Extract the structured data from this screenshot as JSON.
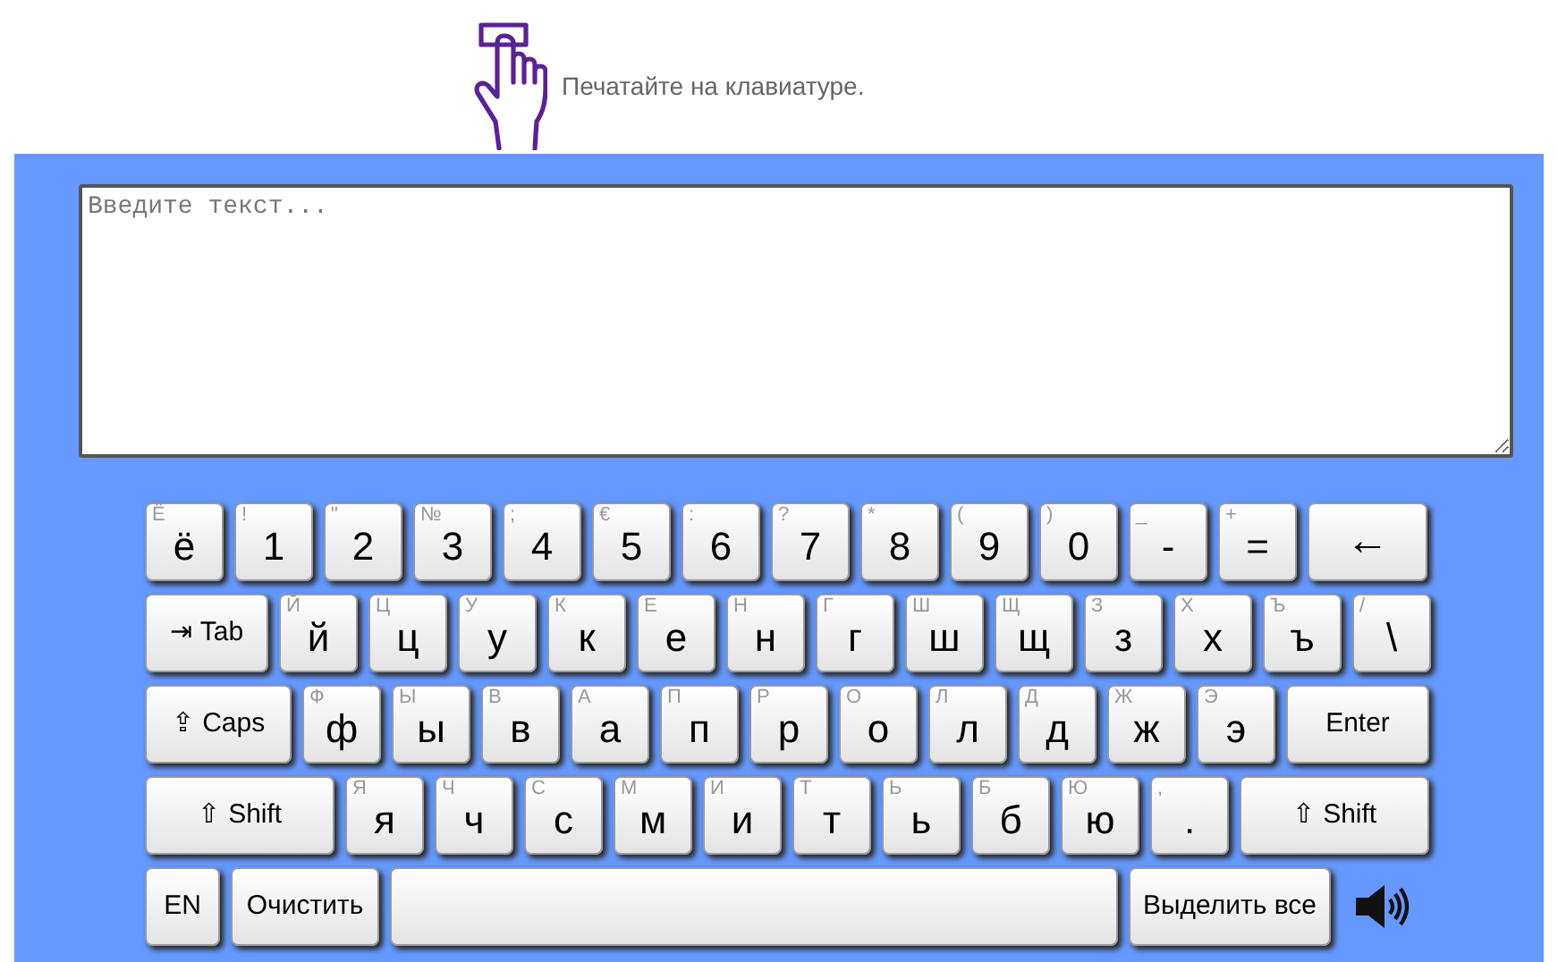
{
  "header": {
    "text": "Печатайте на клавиатуре."
  },
  "editor": {
    "placeholder": "Введите текст..."
  },
  "keyboard": {
    "rows": [
      {
        "keys": [
          {
            "kind": "char",
            "label": "ё",
            "hint": "Ё"
          },
          {
            "kind": "char",
            "label": "1",
            "hint": "!"
          },
          {
            "kind": "char",
            "label": "2",
            "hint": "\""
          },
          {
            "kind": "char",
            "label": "3",
            "hint": "№"
          },
          {
            "kind": "char",
            "label": "4",
            "hint": ";"
          },
          {
            "kind": "char",
            "label": "5",
            "hint": "€"
          },
          {
            "kind": "char",
            "label": "6",
            "hint": ":"
          },
          {
            "kind": "char",
            "label": "7",
            "hint": "?"
          },
          {
            "kind": "char",
            "label": "8",
            "hint": "*"
          },
          {
            "kind": "char",
            "label": "9",
            "hint": "("
          },
          {
            "kind": "char",
            "label": "0",
            "hint": ")"
          },
          {
            "kind": "char",
            "label": "-",
            "hint": "_"
          },
          {
            "kind": "char",
            "label": "=",
            "hint": "+"
          },
          {
            "kind": "backspace",
            "label": "←"
          }
        ]
      },
      {
        "keys": [
          {
            "kind": "tab",
            "label": "⇥ Tab"
          },
          {
            "kind": "char",
            "label": "й",
            "hint": "Й"
          },
          {
            "kind": "char",
            "label": "ц",
            "hint": "Ц"
          },
          {
            "kind": "char",
            "label": "у",
            "hint": "У"
          },
          {
            "kind": "char",
            "label": "к",
            "hint": "К"
          },
          {
            "kind": "char",
            "label": "е",
            "hint": "Е"
          },
          {
            "kind": "char",
            "label": "н",
            "hint": "Н"
          },
          {
            "kind": "char",
            "label": "г",
            "hint": "Г"
          },
          {
            "kind": "char",
            "label": "ш",
            "hint": "Ш"
          },
          {
            "kind": "char",
            "label": "щ",
            "hint": "Щ"
          },
          {
            "kind": "char",
            "label": "з",
            "hint": "З"
          },
          {
            "kind": "char",
            "label": "х",
            "hint": "Х"
          },
          {
            "kind": "char",
            "label": "ъ",
            "hint": "Ъ"
          },
          {
            "kind": "char",
            "label": "\\",
            "hint": "/"
          }
        ]
      },
      {
        "keys": [
          {
            "kind": "caps",
            "label": "⇪ Caps"
          },
          {
            "kind": "char",
            "label": "ф",
            "hint": "Ф"
          },
          {
            "kind": "char",
            "label": "ы",
            "hint": "Ы"
          },
          {
            "kind": "char",
            "label": "в",
            "hint": "В"
          },
          {
            "kind": "char",
            "label": "а",
            "hint": "А"
          },
          {
            "kind": "char",
            "label": "п",
            "hint": "П"
          },
          {
            "kind": "char",
            "label": "р",
            "hint": "Р"
          },
          {
            "kind": "char",
            "label": "о",
            "hint": "О"
          },
          {
            "kind": "char",
            "label": "л",
            "hint": "Л"
          },
          {
            "kind": "char",
            "label": "д",
            "hint": "Д"
          },
          {
            "kind": "char",
            "label": "ж",
            "hint": "Ж"
          },
          {
            "kind": "char",
            "label": "э",
            "hint": "Э"
          },
          {
            "kind": "enter",
            "label": "Enter"
          }
        ]
      },
      {
        "keys": [
          {
            "kind": "shift",
            "label": "⇧ Shift"
          },
          {
            "kind": "char",
            "label": "я",
            "hint": "Я"
          },
          {
            "kind": "char",
            "label": "ч",
            "hint": "Ч"
          },
          {
            "kind": "char",
            "label": "с",
            "hint": "С"
          },
          {
            "kind": "char",
            "label": "м",
            "hint": "М"
          },
          {
            "kind": "char",
            "label": "и",
            "hint": "И"
          },
          {
            "kind": "char",
            "label": "т",
            "hint": "Т"
          },
          {
            "kind": "char",
            "label": "ь",
            "hint": "Ь"
          },
          {
            "kind": "char",
            "label": "б",
            "hint": "Б"
          },
          {
            "kind": "char",
            "label": "ю",
            "hint": "Ю"
          },
          {
            "kind": "char",
            "label": ".",
            "hint": ","
          },
          {
            "kind": "shift",
            "label": "⇧ Shift"
          }
        ]
      },
      {
        "keys": [
          {
            "kind": "lang",
            "label": "EN"
          },
          {
            "kind": "clear",
            "label": "Очистить"
          },
          {
            "kind": "space"
          },
          {
            "kind": "select_all",
            "label": "Выделить все"
          },
          {
            "kind": "sound"
          }
        ]
      }
    ]
  }
}
